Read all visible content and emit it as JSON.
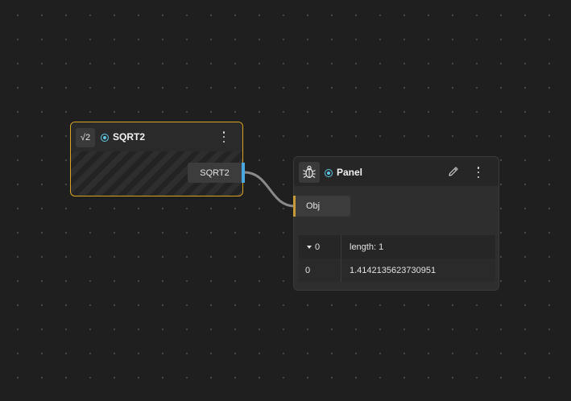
{
  "sqrt2_node": {
    "icon": "sqrt-icon",
    "icon_text": "√2",
    "title": "SQRT2",
    "output_label": "SQRT2",
    "border_color": "#d9a520"
  },
  "panel_node": {
    "icon": "bug-icon",
    "title": "Panel",
    "input_label": "Obj",
    "table": {
      "header": {
        "index": "0",
        "value": "length: 1"
      },
      "rows": [
        {
          "index": "0",
          "value": "1.4142135623730951"
        }
      ]
    }
  },
  "colors": {
    "status": "#5ec8e5",
    "output_handle": "#4aa8e0",
    "input_handle": "#c99a3a",
    "wire": "#8a8a8a",
    "background": "#1f1f1f"
  }
}
